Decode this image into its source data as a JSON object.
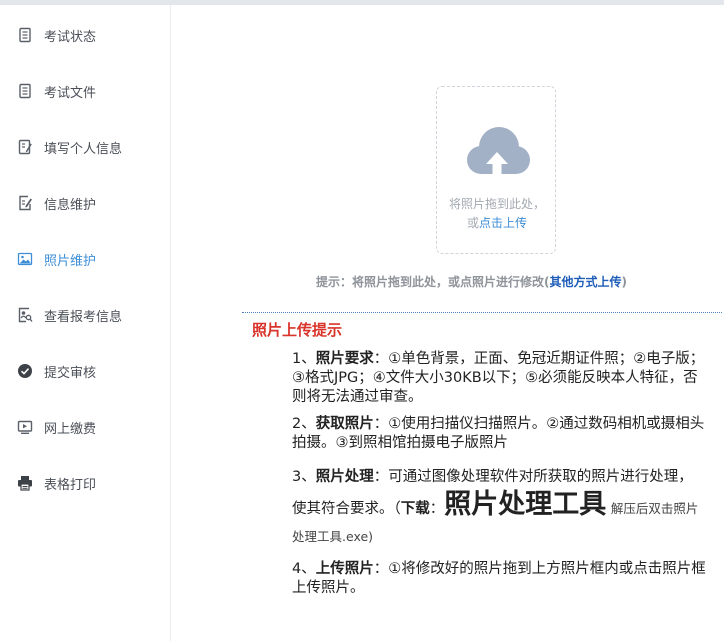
{
  "sidebar": {
    "items": [
      {
        "label": "考试状态",
        "icon": "document-icon",
        "active": false
      },
      {
        "label": "考试文件",
        "icon": "document-icon",
        "active": false
      },
      {
        "label": "填写个人信息",
        "icon": "form-edit-icon",
        "active": false
      },
      {
        "label": "信息维护",
        "icon": "edit-document-icon",
        "active": false
      },
      {
        "label": "照片维护",
        "icon": "image-icon",
        "active": true
      },
      {
        "label": "查看报考信息",
        "icon": "search-profile-icon",
        "active": false
      },
      {
        "label": "提交审核",
        "icon": "check-circle-icon",
        "active": false
      },
      {
        "label": "网上缴费",
        "icon": "payment-icon",
        "active": false
      },
      {
        "label": "表格打印",
        "icon": "printer-icon",
        "active": false
      }
    ]
  },
  "upload": {
    "drag_text": "将照片拖到此处，",
    "or_text": "或",
    "click_text": "点击上传",
    "icon": "cloud-upload-icon"
  },
  "hint": {
    "text": "提示：将照片拖到此处，或点照片进行修改(",
    "link": "其他方式上传",
    "close": ")"
  },
  "tips": {
    "title": "照片上传提示",
    "items": [
      {
        "num": "1、",
        "heading": "照片要求",
        "text": "：①单色背景，正面、免冠近期证件照；②电子版；③格式JPG；④文件大小30KB以下；⑤必须能反映本人特征，否则将无法通过审查。"
      },
      {
        "num": "2、",
        "heading": "获取照片",
        "text": "：①使用扫描仪扫描照片。②通过数码相机或摄相头拍摄。③到照相馆拍摄电子版照片"
      },
      {
        "num": "3、",
        "heading": "照片处理",
        "text": "：可通过图像处理软件对所获取的照片进行处理，使其符合要求。（",
        "download_label": "下载",
        "download_colon": "：",
        "tool_link": "照片处理工具",
        "after": "解压后双击照片处理工具.exe)"
      },
      {
        "num": "4、",
        "heading": "上传照片",
        "text": "：①将修改好的照片拖到上方照片框内或点击照片框上传照片。"
      }
    ]
  },
  "colors": {
    "accent": "#3d8ed6",
    "cloud": "#a3b1c6",
    "title_red": "#d9342b",
    "link_dark_blue": "#1f5db8"
  }
}
